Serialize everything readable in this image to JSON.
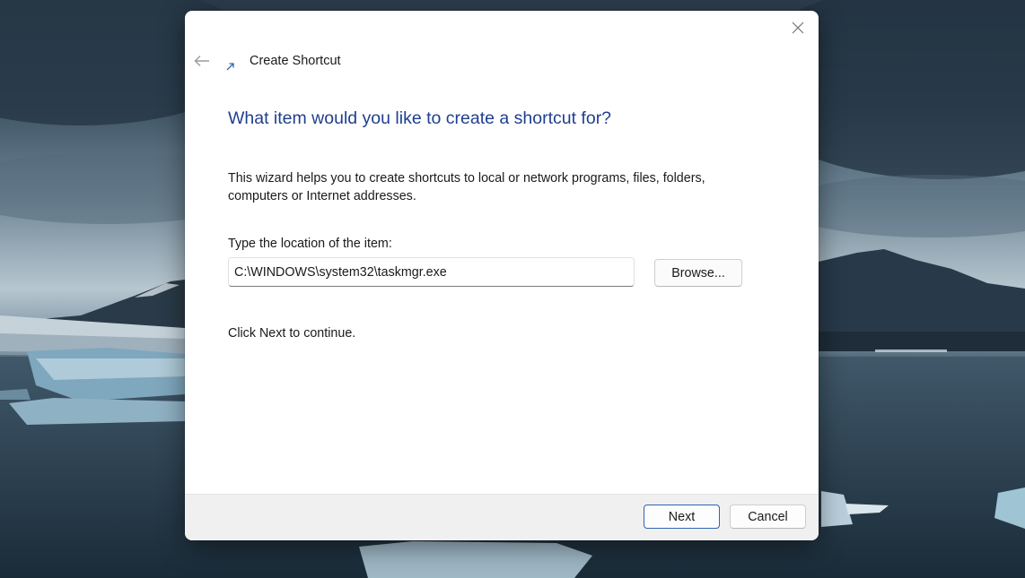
{
  "wizard": {
    "title": "Create Shortcut",
    "heading": "What item would you like to create a shortcut for?",
    "description": "This wizard helps you to create shortcuts to local or network programs, files, folders, computers or Internet addresses.",
    "location_label": "Type the location of the item:",
    "location_value": "C:\\WINDOWS\\system32\\taskmgr.exe",
    "browse_label": "Browse...",
    "continue_text": "Click Next to continue.",
    "next_label": "Next",
    "cancel_label": "Cancel"
  },
  "icons": {
    "close": "close-icon",
    "back": "back-arrow-icon",
    "shortcut": "shortcut-arrow-icon"
  },
  "colors": {
    "heading": "#1f3f8f",
    "accent": "#2f64b0",
    "footer": "#f0f0f0"
  }
}
